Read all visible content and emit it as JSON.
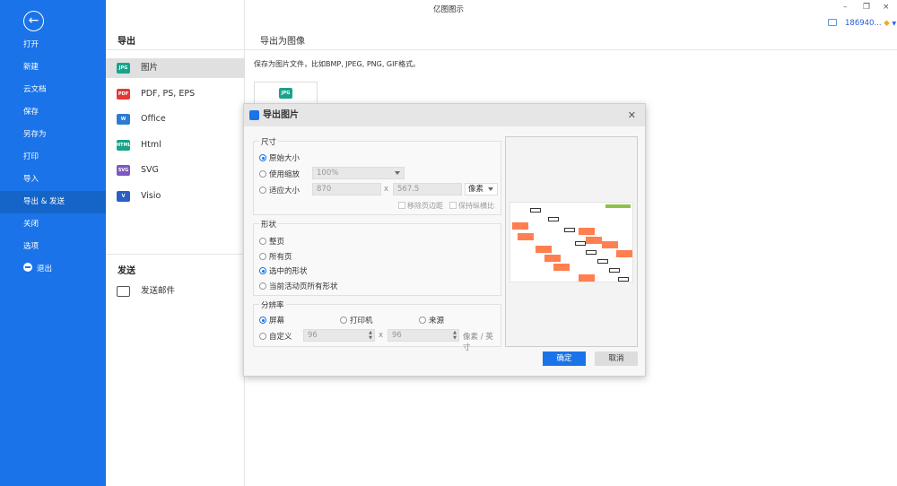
{
  "app": {
    "title": "亿图图示",
    "user": "186940...",
    "window": {
      "minimize": "–",
      "restore": "❐",
      "close": "×"
    }
  },
  "sidebar": {
    "items": [
      {
        "label": "打开"
      },
      {
        "label": "新建"
      },
      {
        "label": "云文档"
      },
      {
        "label": "保存"
      },
      {
        "label": "另存为"
      },
      {
        "label": "打印"
      },
      {
        "label": "导入"
      },
      {
        "label": "导出 & 发送",
        "active": true
      },
      {
        "label": "关闭"
      },
      {
        "label": "选项"
      },
      {
        "label": "退出"
      }
    ]
  },
  "export": {
    "heading": "导出",
    "items": [
      {
        "label": "图片",
        "icon": "JPG",
        "color": "#1aa38a"
      },
      {
        "label": "PDF, PS, EPS",
        "icon": "PDF",
        "color": "#e53935"
      },
      {
        "label": "Office",
        "icon": "W",
        "color": "#2b7cd3"
      },
      {
        "label": "Html",
        "icon": "HTML",
        "color": "#1aa38a"
      },
      {
        "label": "SVG",
        "icon": "SVG",
        "color": "#7e57c2"
      },
      {
        "label": "Visio",
        "icon": "V",
        "color": "#2b5fc4"
      }
    ],
    "send_heading": "发送",
    "send_items": [
      {
        "label": "发送邮件"
      }
    ]
  },
  "main": {
    "title": "导出为图像",
    "description": "保存为图片文件，比如BMP, JPEG, PNG, GIF格式。",
    "thumb_icon": "JPG"
  },
  "dialog": {
    "title": "导出图片",
    "close": "✕",
    "size": {
      "label": "尺寸",
      "original": "原始大小",
      "use_zoom": "使用缩放",
      "zoom_value": "100%",
      "fit": "适应大小",
      "width": "870",
      "x": "x",
      "height": "567.5",
      "unit": "像素",
      "remove_margin": "移除页边距",
      "keep_ratio": "保持纵横比"
    },
    "shape": {
      "label": "形状",
      "options": [
        "整页",
        "所有页",
        "选中的形状",
        "当前活动页所有形状"
      ],
      "selected": 2
    },
    "resolution": {
      "label": "分辨率",
      "screen": "屏幕",
      "printer": "打印机",
      "source": "来源",
      "custom": "自定义",
      "dpi_x": "96",
      "x": "x",
      "dpi_y": "96",
      "unit": "像素 / 英寸"
    },
    "ok": "确定",
    "cancel": "取消"
  },
  "colors": {
    "accent": "#1a73e8",
    "shape_orange": "#ff7f50",
    "tag_green": "#8bc34a"
  }
}
